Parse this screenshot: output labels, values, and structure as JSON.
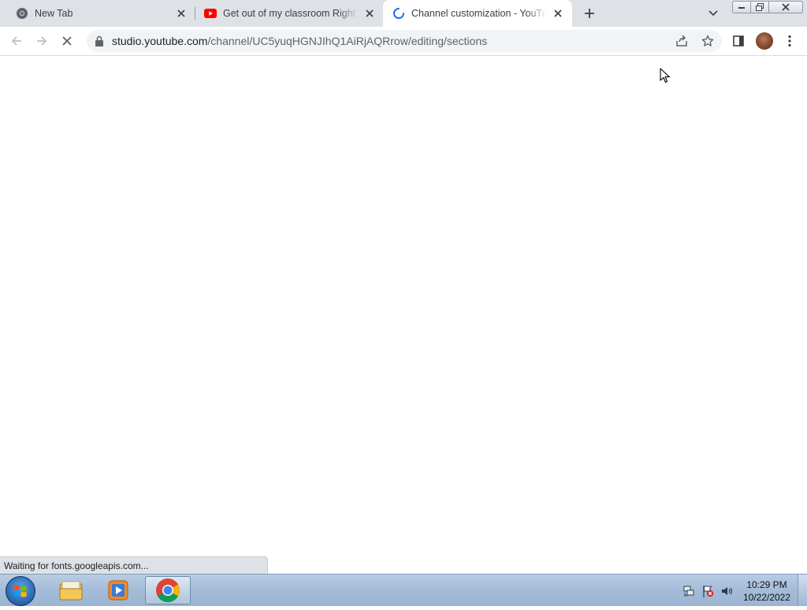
{
  "browser": {
    "tabs": [
      {
        "title": "New Tab",
        "icon": "chrome-icon",
        "active": false
      },
      {
        "title": "Get out of my classroom Right now",
        "icon": "youtube-icon",
        "active": false
      },
      {
        "title": "Channel customization - YouTube Studio",
        "icon": "loading-spinner-icon",
        "active": true
      }
    ],
    "url_host": "studio.youtube.com",
    "url_path": "/channel/UC5yuqHGNJIhQ1AiRjAQRrow/editing/sections",
    "status_text": "Waiting for fonts.googleapis.com..."
  },
  "taskbar": {
    "apps": [
      {
        "name": "file-explorer-icon"
      },
      {
        "name": "media-player-icon"
      },
      {
        "name": "chrome-icon",
        "active": true
      }
    ],
    "clock_time": "10:29 PM",
    "clock_date": "10/22/2022"
  },
  "colors": {
    "youtube_red": "#ff0000",
    "spinner_blue": "#1a73e8",
    "tab_strip": "#dee1e6"
  }
}
